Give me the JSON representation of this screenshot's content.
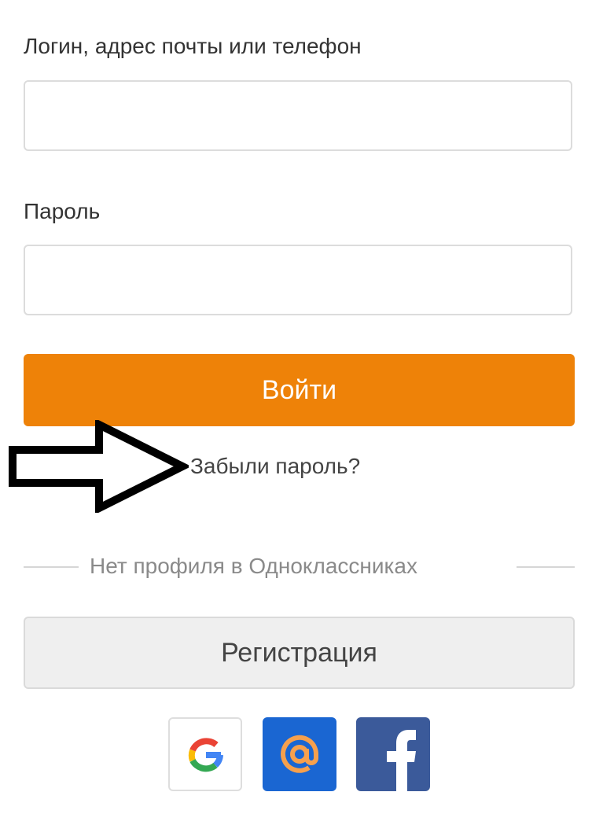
{
  "login_form": {
    "login_label": "Логин, адрес почты или телефон",
    "login_value": "",
    "password_label": "Пароль",
    "password_value": "",
    "submit_label": "Войти",
    "forgot_password_label": "Забыли пароль?"
  },
  "registration": {
    "divider_text": "Нет профиля в Одноклассниках",
    "register_label": "Регистрация"
  },
  "social_login": {
    "providers": [
      {
        "name": "google",
        "icon": "google-icon"
      },
      {
        "name": "mail",
        "icon": "at-sign-icon"
      },
      {
        "name": "facebook",
        "icon": "facebook-icon"
      }
    ]
  },
  "annotation": {
    "icon": "arrow-right-icon"
  },
  "colors": {
    "accent": "#ee8208",
    "mail": "#1a66d2",
    "facebook": "#3b5a9a"
  }
}
